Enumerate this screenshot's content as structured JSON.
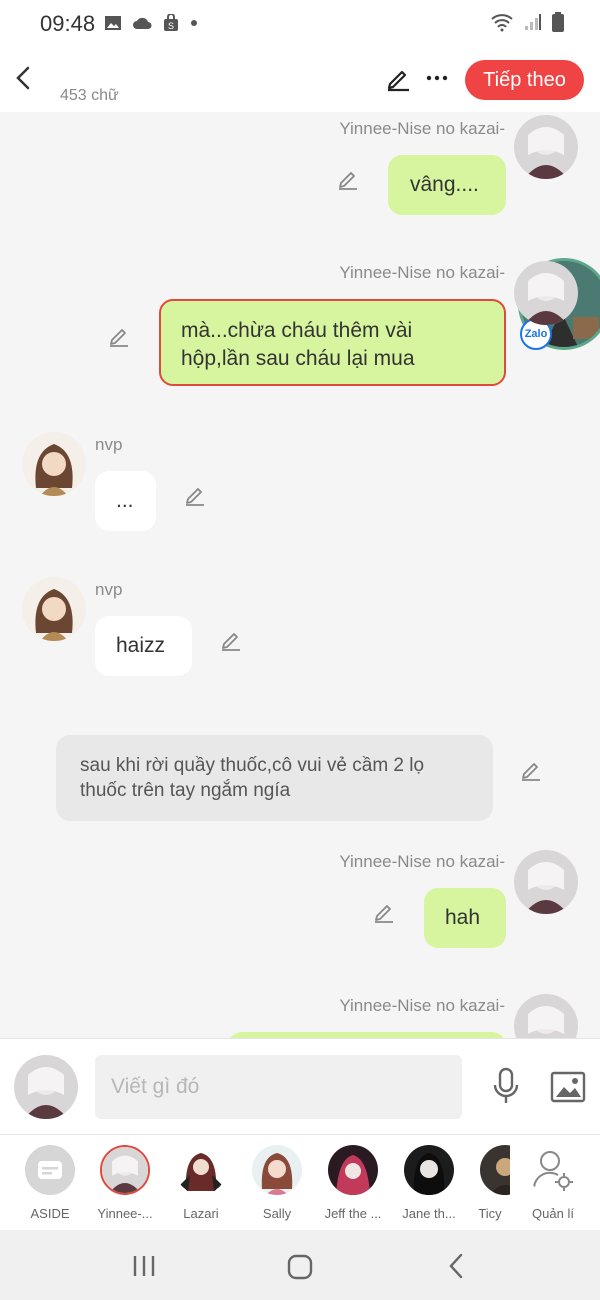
{
  "status": {
    "time": "09:48"
  },
  "header": {
    "word_count": "453 chữ",
    "next_label": "Tiếp theo"
  },
  "chat": {
    "messages": [
      {
        "name": "Yinnee-Nise no kazai-",
        "text": "vâng...."
      },
      {
        "name": "Yinnee-Nise no kazai-",
        "text_line1": "mà...chừa cháu thêm vài",
        "text_line2": "hộp,lần sau cháu lại mua"
      },
      {
        "name": "nvp",
        "text": "..."
      },
      {
        "name": "nvp",
        "text": "haizz"
      },
      {
        "narration_line1": "sau khi rời quầy thuốc,cô vui vẻ cầm 2 lọ",
        "narration_line2": "thuốc trên tay ngắm ngía"
      },
      {
        "name": "Yinnee-Nise no kazai-",
        "text": "hah"
      },
      {
        "name": "Yinnee-Nise no kazai-"
      }
    ],
    "zalo_label": "Zalo"
  },
  "composer": {
    "placeholder": "Viết gì đó"
  },
  "characters": [
    {
      "label": "ASIDE"
    },
    {
      "label": "Yinnee-..."
    },
    {
      "label": "Lazari"
    },
    {
      "label": "Sally"
    },
    {
      "label": "Jeff the ..."
    },
    {
      "label": "Jane th..."
    },
    {
      "label": "Ticy"
    },
    {
      "label": "Quản lí"
    }
  ],
  "colors": {
    "accent": "#f04343",
    "bubble_green": "#d6f59e",
    "selected_border": "#e04a3c"
  }
}
